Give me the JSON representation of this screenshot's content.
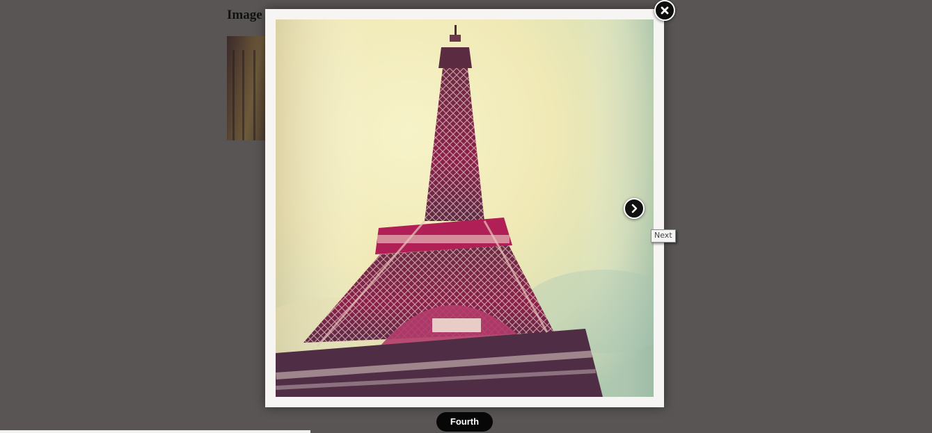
{
  "page": {
    "heading": "Image"
  },
  "lightbox": {
    "caption": "Fourth",
    "next_tooltip": "Next",
    "image_subject": "eiffel-tower-photo"
  },
  "icons": {
    "close": "close-icon",
    "next": "chevron-right-icon"
  },
  "colors": {
    "overlay": "#595555",
    "frame": "#f7f5f4",
    "caption_bg": "#070707",
    "button_bg": "#0d0d0d"
  }
}
